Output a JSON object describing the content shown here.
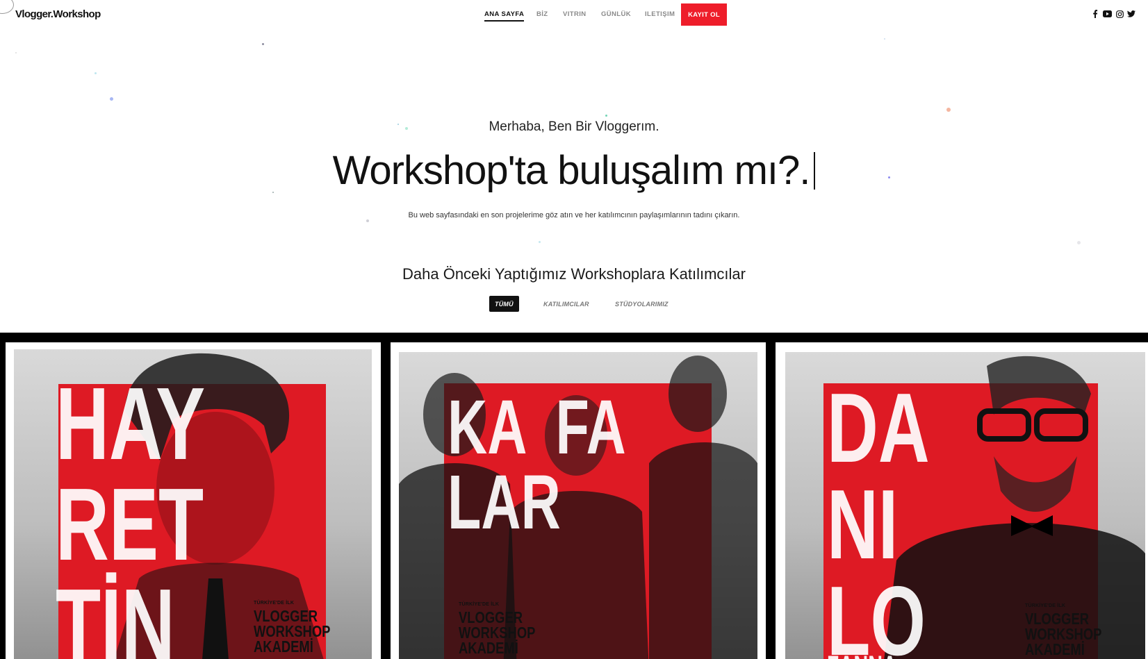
{
  "header": {
    "logo": "Vlogger.Workshop",
    "nav": [
      {
        "label": "ANA SAYFA",
        "active": true
      },
      {
        "label": "BİZ",
        "active": false
      },
      {
        "label": "VITRIN",
        "active": false
      },
      {
        "label": "GÜNLÜK",
        "active": false
      },
      {
        "label": "ILETIŞIM",
        "active": false
      }
    ],
    "cta": "KAYIT OL",
    "social": [
      "facebook-icon",
      "youtube-icon",
      "instagram-icon",
      "twitter-icon"
    ]
  },
  "hero": {
    "greeting": "Merhaba, Ben Bir Vloggerım.",
    "title": "Workshop'ta buluşalım mı?.",
    "subtitle": "Bu web sayfasındaki en son projelerime göz atın ve her katılımcının paylaşımlarının tadını çıkarın."
  },
  "portfolio": {
    "title": "Daha Önceki Yaptığımız Workshoplara Katılımcılar",
    "filters": [
      {
        "label": "TÜMÜ",
        "active": true
      },
      {
        "label": "KATILIMCILAR",
        "active": false
      },
      {
        "label": "STÜDYOLARIMIZ",
        "active": false
      }
    ],
    "cards": [
      {
        "letters": "HAY\nRET\nTİN",
        "tag": "TÜRKİYE'DE İLK",
        "brand": "VLOGGER\nWORKSHOP\nAKADEMİ"
      },
      {
        "letters": "KA  FA\nLAR",
        "tag": "TÜRKİYE'DE İLK",
        "brand": "VLOGGER\nWORKSHOP\nAKADEMİ"
      },
      {
        "letters": "DA\nNI\nLO",
        "tag": "TÜRKİYE'DE İLK",
        "brand": "VLOGGER\nWORKSHOP\nAKADEMİ",
        "extra": "ZANNA"
      }
    ]
  },
  "colors": {
    "accent": "#ee1d2a",
    "poster_red": "#de1a24",
    "gallery_bg": "#000000"
  }
}
